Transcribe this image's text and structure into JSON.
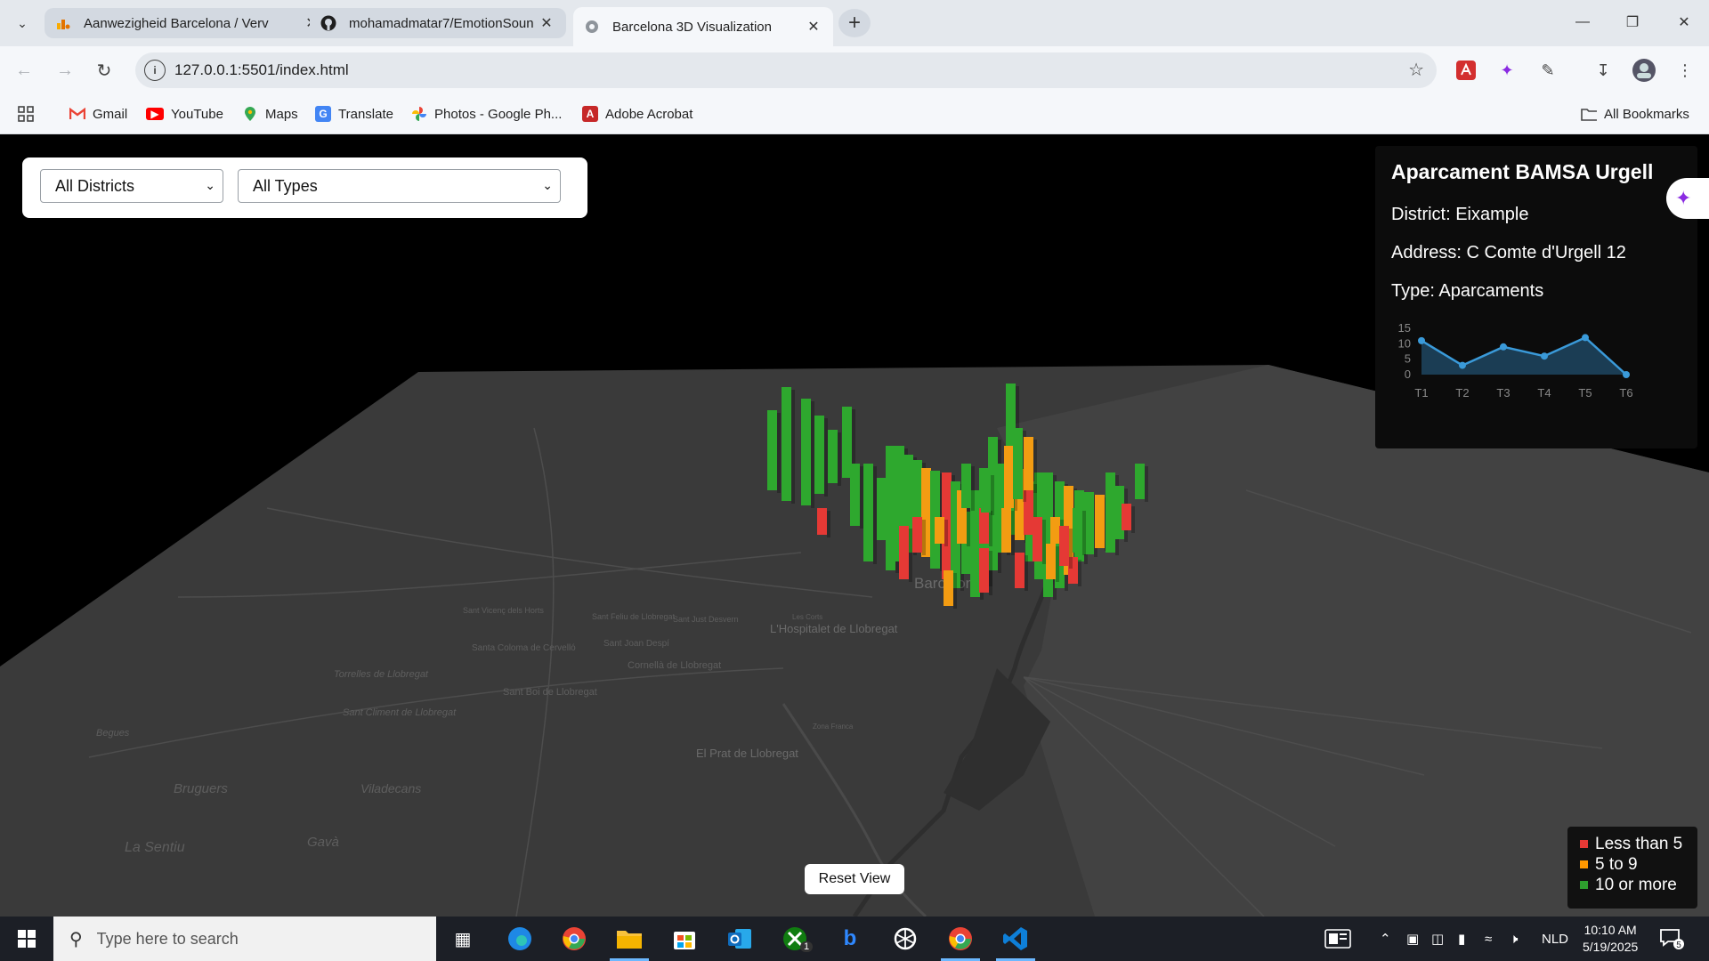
{
  "browser": {
    "tabs": [
      {
        "title": "Aanwezigheid Barcelona / Verv",
        "icon": "analytics-favicon"
      },
      {
        "title": "mohamadmatar7/EmotionSoun",
        "icon": "github-favicon"
      },
      {
        "title": "Barcelona 3D Visualization",
        "icon": "globe-favicon",
        "active": true
      }
    ],
    "url": "127.0.0.1:5501/index.html",
    "bookmarks": [
      "Gmail",
      "YouTube",
      "Maps",
      "Translate",
      "Photos - Google Ph...",
      "Adobe Acrobat"
    ],
    "all_bookmarks": "All Bookmarks"
  },
  "filters": {
    "district": "All Districts",
    "type": "All Types"
  },
  "info": {
    "name": "Aparcament BAMSA Urgell",
    "district": "District: Eixample",
    "address": "Address: C Comte d'Urgell 12",
    "type": "Type: Aparcaments"
  },
  "chart_data": {
    "type": "area",
    "categories": [
      "T1",
      "T2",
      "T3",
      "T4",
      "T5",
      "T6"
    ],
    "values": [
      11,
      3,
      9,
      6,
      12,
      0
    ],
    "yticks": [
      0,
      5,
      10,
      15
    ],
    "ylim": [
      0,
      15
    ],
    "color": "#3a9ad9"
  },
  "map_labels": [
    "Barcelona",
    "L'Hospitalet de Llobregat",
    "El Prat de Llobregat",
    "Viladecans",
    "Gavà",
    "Bruguers",
    "La Sentiu",
    "Sant Boi de Llobregat",
    "Cornellà de Llobregat",
    "Sant Joan Despí",
    "Santa Coloma de Cervelló",
    "Torrelles de Llobregat",
    "Sant Climent de Llobregat",
    "Sant Vicenç dels Horts",
    "Sant Feliu de Llobregat",
    "Sant Just Desvern",
    "Les Corts",
    "Zona Franca",
    "Begues"
  ],
  "reset_label": "Reset View",
  "legend": [
    {
      "label": "Less than 5",
      "color": "#e53935"
    },
    {
      "label": "5 to 9",
      "color": "#ff9800"
    },
    {
      "label": "10 or more",
      "color": "#2e9e2e"
    }
  ],
  "taskbar": {
    "search_placeholder": "Type here to search",
    "lang": "NLD",
    "time": "10:10 AM",
    "date": "5/19/2025",
    "notifications": "5",
    "xbox_badge": "1"
  }
}
